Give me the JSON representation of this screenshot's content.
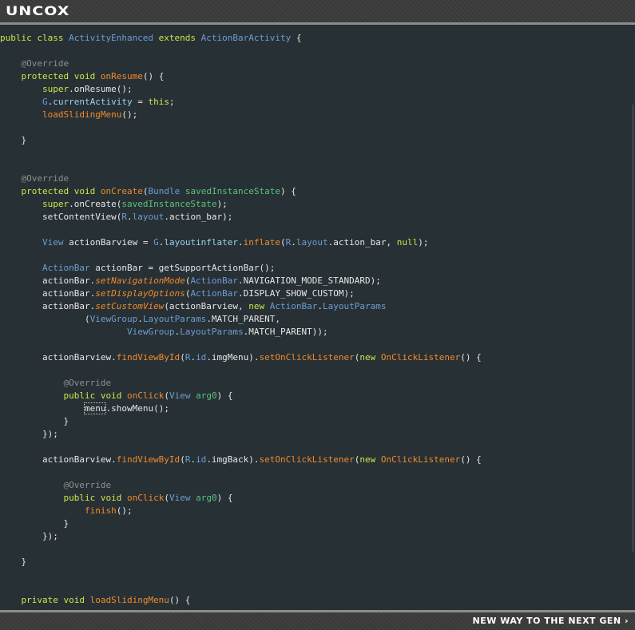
{
  "header": {
    "logo_text": "UNCOX"
  },
  "footer": {
    "tagline": "NEW WAY TO THE NEXT GEN ›"
  },
  "colors": {
    "editor_background": "#273035",
    "keyword": "#cbe64a",
    "annotation": "#8f8f8f",
    "type": "#6f9cd1",
    "method": "#f08a2c",
    "field": "#9ed2ef",
    "variable": "#5bc27a",
    "plain": "#e6e6e6"
  },
  "code": {
    "lines": [
      [
        {
          "t": "kw",
          "v": "public class "
        },
        {
          "t": "ty",
          "v": "ActivityEnhanced"
        },
        {
          "t": "kw",
          "v": " extends "
        },
        {
          "t": "ty",
          "v": "ActionBarActivity"
        },
        {
          "t": "txt",
          "v": " {"
        }
      ],
      [],
      [
        {
          "t": "txt",
          "v": "    "
        },
        {
          "t": "ann",
          "v": "@Override"
        }
      ],
      [
        {
          "t": "txt",
          "v": "    "
        },
        {
          "t": "kw",
          "v": "protected void "
        },
        {
          "t": "mth",
          "v": "onResume"
        },
        {
          "t": "txt",
          "v": "() {"
        }
      ],
      [
        {
          "t": "txt",
          "v": "        "
        },
        {
          "t": "kw",
          "v": "super"
        },
        {
          "t": "txt",
          "v": ".onResume();"
        }
      ],
      [
        {
          "t": "txt",
          "v": "        "
        },
        {
          "t": "ty",
          "v": "G"
        },
        {
          "t": "txt",
          "v": "."
        },
        {
          "t": "fld",
          "v": "currentActivity"
        },
        {
          "t": "txt",
          "v": " = "
        },
        {
          "t": "kw",
          "v": "this"
        },
        {
          "t": "txt",
          "v": ";"
        }
      ],
      [
        {
          "t": "txt",
          "v": "        "
        },
        {
          "t": "mth",
          "v": "loadSlidingMenu"
        },
        {
          "t": "txt",
          "v": "();"
        }
      ],
      [],
      [
        {
          "t": "txt",
          "v": "    }"
        }
      ],
      [],
      [],
      [
        {
          "t": "txt",
          "v": "    "
        },
        {
          "t": "ann",
          "v": "@Override"
        }
      ],
      [
        {
          "t": "txt",
          "v": "    "
        },
        {
          "t": "kw",
          "v": "protected void "
        },
        {
          "t": "mth",
          "v": "onCreate"
        },
        {
          "t": "txt",
          "v": "("
        },
        {
          "t": "ty",
          "v": "Bundle"
        },
        {
          "t": "txt",
          "v": " "
        },
        {
          "t": "var",
          "v": "savedInstanceState"
        },
        {
          "t": "txt",
          "v": ") {"
        }
      ],
      [
        {
          "t": "txt",
          "v": "        "
        },
        {
          "t": "kw",
          "v": "super"
        },
        {
          "t": "txt",
          "v": ".onCreate("
        },
        {
          "t": "var",
          "v": "savedInstanceState"
        },
        {
          "t": "txt",
          "v": ");"
        }
      ],
      [
        {
          "t": "txt",
          "v": "        setContentView("
        },
        {
          "t": "ty",
          "v": "R"
        },
        {
          "t": "txt",
          "v": "."
        },
        {
          "t": "ty",
          "v": "layout"
        },
        {
          "t": "txt",
          "v": ".action_bar);"
        }
      ],
      [],
      [
        {
          "t": "txt",
          "v": "        "
        },
        {
          "t": "ty",
          "v": "View"
        },
        {
          "t": "txt",
          "v": " actionBarview = "
        },
        {
          "t": "ty",
          "v": "G"
        },
        {
          "t": "txt",
          "v": "."
        },
        {
          "t": "fld",
          "v": "layoutinflater"
        },
        {
          "t": "txt",
          "v": "."
        },
        {
          "t": "mth",
          "v": "inflate"
        },
        {
          "t": "txt",
          "v": "("
        },
        {
          "t": "ty",
          "v": "R"
        },
        {
          "t": "txt",
          "v": "."
        },
        {
          "t": "ty",
          "v": "layout"
        },
        {
          "t": "txt",
          "v": ".action_bar, "
        },
        {
          "t": "kw",
          "v": "null"
        },
        {
          "t": "txt",
          "v": ");"
        }
      ],
      [],
      [
        {
          "t": "txt",
          "v": "        "
        },
        {
          "t": "ty",
          "v": "ActionBar"
        },
        {
          "t": "txt",
          "v": " actionBar = getSupportActionBar();"
        }
      ],
      [
        {
          "t": "txt",
          "v": "        actionBar."
        },
        {
          "t": "st",
          "v": "setNavigationMode"
        },
        {
          "t": "txt",
          "v": "("
        },
        {
          "t": "ty",
          "v": "ActionBar"
        },
        {
          "t": "txt",
          "v": ".NAVIGATION_MODE_STANDARD);"
        }
      ],
      [
        {
          "t": "txt",
          "v": "        actionBar."
        },
        {
          "t": "st",
          "v": "setDisplayOptions"
        },
        {
          "t": "txt",
          "v": "("
        },
        {
          "t": "ty",
          "v": "ActionBar"
        },
        {
          "t": "txt",
          "v": ".DISPLAY_SHOW_CUSTOM);"
        }
      ],
      [
        {
          "t": "txt",
          "v": "        actionBar."
        },
        {
          "t": "st",
          "v": "setCustomView"
        },
        {
          "t": "txt",
          "v": "(actionBarview, "
        },
        {
          "t": "kw",
          "v": "new "
        },
        {
          "t": "ty",
          "v": "ActionBar"
        },
        {
          "t": "txt",
          "v": "."
        },
        {
          "t": "ty",
          "v": "LayoutParams"
        }
      ],
      [
        {
          "t": "txt",
          "v": "                ("
        },
        {
          "t": "ty",
          "v": "ViewGroup"
        },
        {
          "t": "txt",
          "v": "."
        },
        {
          "t": "ty",
          "v": "LayoutParams"
        },
        {
          "t": "txt",
          "v": ".MATCH_PARENT,"
        }
      ],
      [
        {
          "t": "txt",
          "v": "                        "
        },
        {
          "t": "ty",
          "v": "ViewGroup"
        },
        {
          "t": "txt",
          "v": "."
        },
        {
          "t": "ty",
          "v": "LayoutParams"
        },
        {
          "t": "txt",
          "v": ".MATCH_PARENT));"
        }
      ],
      [],
      [
        {
          "t": "txt",
          "v": "        actionBarview."
        },
        {
          "t": "mth",
          "v": "findViewById"
        },
        {
          "t": "txt",
          "v": "("
        },
        {
          "t": "ty",
          "v": "R"
        },
        {
          "t": "txt",
          "v": "."
        },
        {
          "t": "ty",
          "v": "id"
        },
        {
          "t": "txt",
          "v": ".imgMenu)."
        },
        {
          "t": "mth",
          "v": "setOnClickListener"
        },
        {
          "t": "txt",
          "v": "("
        },
        {
          "t": "kw",
          "v": "new "
        },
        {
          "t": "mth",
          "v": "OnClickListener"
        },
        {
          "t": "txt",
          "v": "() {"
        }
      ],
      [],
      [
        {
          "t": "txt",
          "v": "            "
        },
        {
          "t": "ann",
          "v": "@Override"
        }
      ],
      [
        {
          "t": "txt",
          "v": "            "
        },
        {
          "t": "kw",
          "v": "public void "
        },
        {
          "t": "mth",
          "v": "onClick"
        },
        {
          "t": "txt",
          "v": "("
        },
        {
          "t": "ty",
          "v": "View"
        },
        {
          "t": "txt",
          "v": " "
        },
        {
          "t": "var",
          "v": "arg0"
        },
        {
          "t": "txt",
          "v": ") {"
        }
      ],
      [
        {
          "t": "txt",
          "v": "                "
        },
        {
          "t": "sel",
          "v": "menu"
        },
        {
          "t": "txt",
          "v": ".showMenu();"
        }
      ],
      [
        {
          "t": "txt",
          "v": "            }"
        }
      ],
      [
        {
          "t": "txt",
          "v": "        });"
        }
      ],
      [],
      [
        {
          "t": "txt",
          "v": "        actionBarview."
        },
        {
          "t": "mth",
          "v": "findViewById"
        },
        {
          "t": "txt",
          "v": "("
        },
        {
          "t": "ty",
          "v": "R"
        },
        {
          "t": "txt",
          "v": "."
        },
        {
          "t": "ty",
          "v": "id"
        },
        {
          "t": "txt",
          "v": ".imgBack)."
        },
        {
          "t": "mth",
          "v": "setOnClickListener"
        },
        {
          "t": "txt",
          "v": "("
        },
        {
          "t": "kw",
          "v": "new "
        },
        {
          "t": "mth",
          "v": "OnClickListener"
        },
        {
          "t": "txt",
          "v": "() {"
        }
      ],
      [],
      [
        {
          "t": "txt",
          "v": "            "
        },
        {
          "t": "ann",
          "v": "@Override"
        }
      ],
      [
        {
          "t": "txt",
          "v": "            "
        },
        {
          "t": "kw",
          "v": "public void "
        },
        {
          "t": "mth",
          "v": "onClick"
        },
        {
          "t": "txt",
          "v": "("
        },
        {
          "t": "ty",
          "v": "View"
        },
        {
          "t": "txt",
          "v": " "
        },
        {
          "t": "var",
          "v": "arg0"
        },
        {
          "t": "txt",
          "v": ") {"
        }
      ],
      [
        {
          "t": "txt",
          "v": "                "
        },
        {
          "t": "mth",
          "v": "finish"
        },
        {
          "t": "txt",
          "v": "();"
        }
      ],
      [
        {
          "t": "txt",
          "v": "            }"
        }
      ],
      [
        {
          "t": "txt",
          "v": "        });"
        }
      ],
      [],
      [
        {
          "t": "txt",
          "v": "    }"
        }
      ],
      [],
      [],
      [
        {
          "t": "txt",
          "v": "    "
        },
        {
          "t": "kw",
          "v": "private void "
        },
        {
          "t": "mth",
          "v": "loadSlidingMenu"
        },
        {
          "t": "txt",
          "v": "() {"
        }
      ]
    ]
  }
}
